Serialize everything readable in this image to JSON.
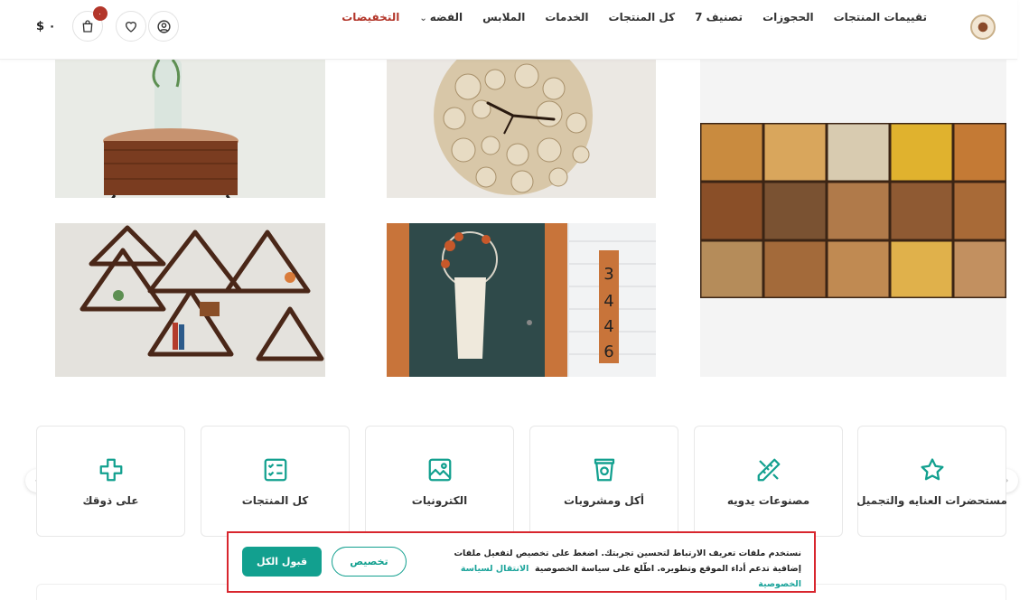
{
  "header": {
    "nav": [
      {
        "label": "التخفيضات",
        "active": true
      },
      {
        "label": "الفضه",
        "has_dropdown": true
      },
      {
        "label": "الملابس"
      },
      {
        "label": "الخدمات"
      },
      {
        "label": "كل المنتجات"
      },
      {
        "label": "تصنيف 7"
      },
      {
        "label": "الحجوزات"
      },
      {
        "label": "تقييمات المنتجات"
      }
    ],
    "cart_price": "$ ٠",
    "cart_count": "٠",
    "icons": {
      "cart": "bag-icon",
      "wishlist": "heart-icon",
      "account": "user-icon",
      "logo": "store-logo"
    }
  },
  "gallery": [
    {
      "name": "wood-stump-table-image"
    },
    {
      "name": "wood-clock-image"
    },
    {
      "name": "wood-blocks-image"
    },
    {
      "name": "triangle-shelves-image"
    },
    {
      "name": "door-wreath-image"
    }
  ],
  "categories": [
    {
      "label": "مستحضرات العنايه والتجميل",
      "icon": "star-icon"
    },
    {
      "label": "مصنوعات يدويه",
      "icon": "ruler-pencil-icon"
    },
    {
      "label": "أكل ومشروبات",
      "icon": "cup-icon"
    },
    {
      "label": "الكترونيات",
      "icon": "image-icon"
    },
    {
      "label": "كل المنتجات",
      "icon": "checklist-icon"
    },
    {
      "label": "على ذوقك",
      "icon": "plus-icon"
    }
  ],
  "cookie": {
    "text": "نستخدم ملفات تعريف الارتباط لتحسين تجربتك. اضغط على تخصيص لتفعيل ملفات إضافية تدعم أداء الموقع وتطويره. اطّلع على سياسة الخصوصية",
    "link": "الانتقال لسياسة الخصوصية",
    "customize_label": "تخصيص",
    "accept_label": "قبول الكل"
  },
  "colors": {
    "accent": "#12a08f",
    "active_nav": "#b3362a",
    "banner_border": "#d8262e"
  }
}
